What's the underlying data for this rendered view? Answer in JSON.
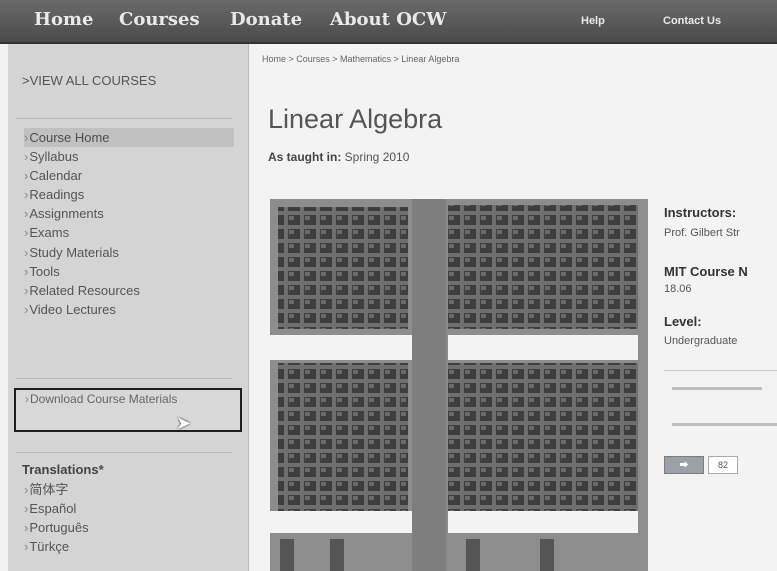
{
  "topnav": {
    "home": "Home",
    "courses": "Courses",
    "donate": "Donate",
    "about": "About OCW",
    "help": "Help",
    "contact": "Contact Us"
  },
  "sidebar": {
    "view_all": ">VIEW ALL COURSES",
    "items": [
      "Course Home",
      "Syllabus",
      "Calendar",
      "Readings",
      "Assignments",
      "Exams",
      "Study Materials",
      "Tools",
      "Related Resources",
      "Video Lectures"
    ],
    "download": "Download Course Materials",
    "translations_title": "Translations*",
    "translations": [
      "简体字",
      "Español",
      "Português",
      "Türkçe"
    ]
  },
  "main": {
    "breadcrumb": "Home > Courses > Mathematics > Linear Algebra",
    "title": "Linear Algebra",
    "taught_label": "As taught in:",
    "taught_value": "Spring 2010"
  },
  "info": {
    "instructors_label": "Instructors:",
    "instructors_value": "Prof. Gilbert Str",
    "course_no_label": "MIT Course N",
    "course_no_value": "18.06",
    "level_label": "Level:",
    "level_value": "Undergraduate",
    "share_count": "82"
  }
}
